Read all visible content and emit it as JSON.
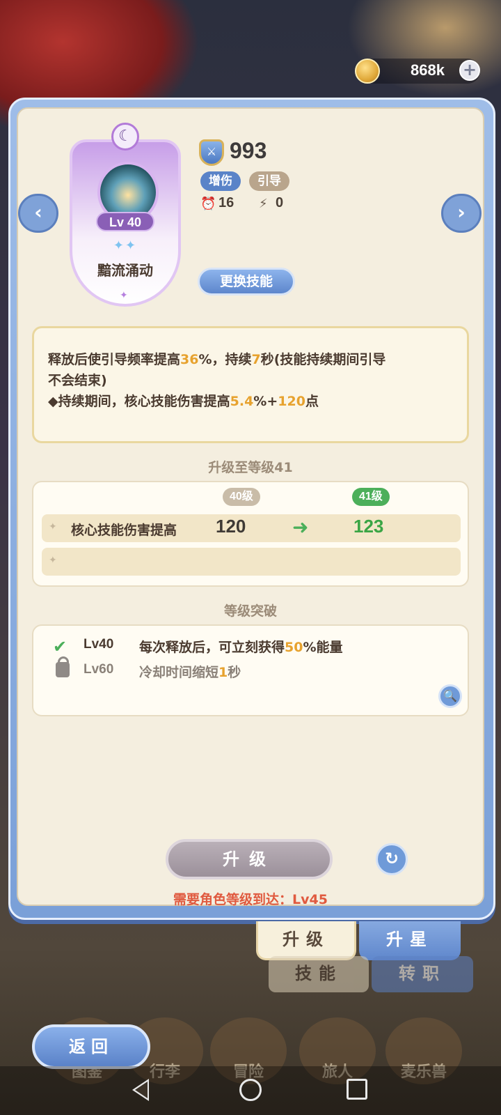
{
  "currency": {
    "value": "868k",
    "icon": "gold-coin-icon",
    "add_label": "+"
  },
  "nav": {
    "left_label": "‹",
    "right_label": "›"
  },
  "skill": {
    "name": "黯流涌动",
    "level": "Lv 40",
    "power": "993",
    "tags": [
      "增伤",
      "引导"
    ],
    "cooldown": "16",
    "energy": "0",
    "change_button": "更换技能"
  },
  "description": {
    "line1_a": "释放后使引导频率提高",
    "line1_b": "36",
    "line1_c": "%，持续",
    "line1_d": "7",
    "line1_e": "秒(技能持续期间引导",
    "line2": "不会结束)",
    "line3_a": "◆持续期间，核心技能伤害提高",
    "line3_b": "5.4",
    "line3_c": "%+",
    "line3_d": "120",
    "line3_e": "点"
  },
  "upgrade": {
    "title": "升级至等级41",
    "current_level": "40级",
    "next_level": "41级",
    "stat_name": "核心技能伤害提高",
    "stat_old": "120",
    "stat_new": "123"
  },
  "breakthrough": {
    "title": "等级突破",
    "items": [
      {
        "level": "Lv40",
        "text_a": "每次释放后，可立刻获得",
        "text_b": "50",
        "text_c": "%能量"
      },
      {
        "level": "Lv60",
        "text_a": "冷却时间缩短",
        "text_b": "1",
        "text_c": "秒"
      }
    ]
  },
  "actions": {
    "upgrade_button": "升级",
    "requirement": "需要角色等级到达：Lv45"
  },
  "tabs": {
    "upgrade": "升级",
    "star": "升星",
    "skill": "技能",
    "job": "转职"
  },
  "bottom_nav": {
    "back": "返回",
    "items": [
      "图鉴",
      "行李",
      "冒险",
      "旅人",
      "麦乐兽"
    ]
  },
  "colors": {
    "accent_blue": "#5d86cc",
    "highlight": "#e7a22e",
    "green": "#4caf5a",
    "requirement_red": "#e05a3f"
  }
}
